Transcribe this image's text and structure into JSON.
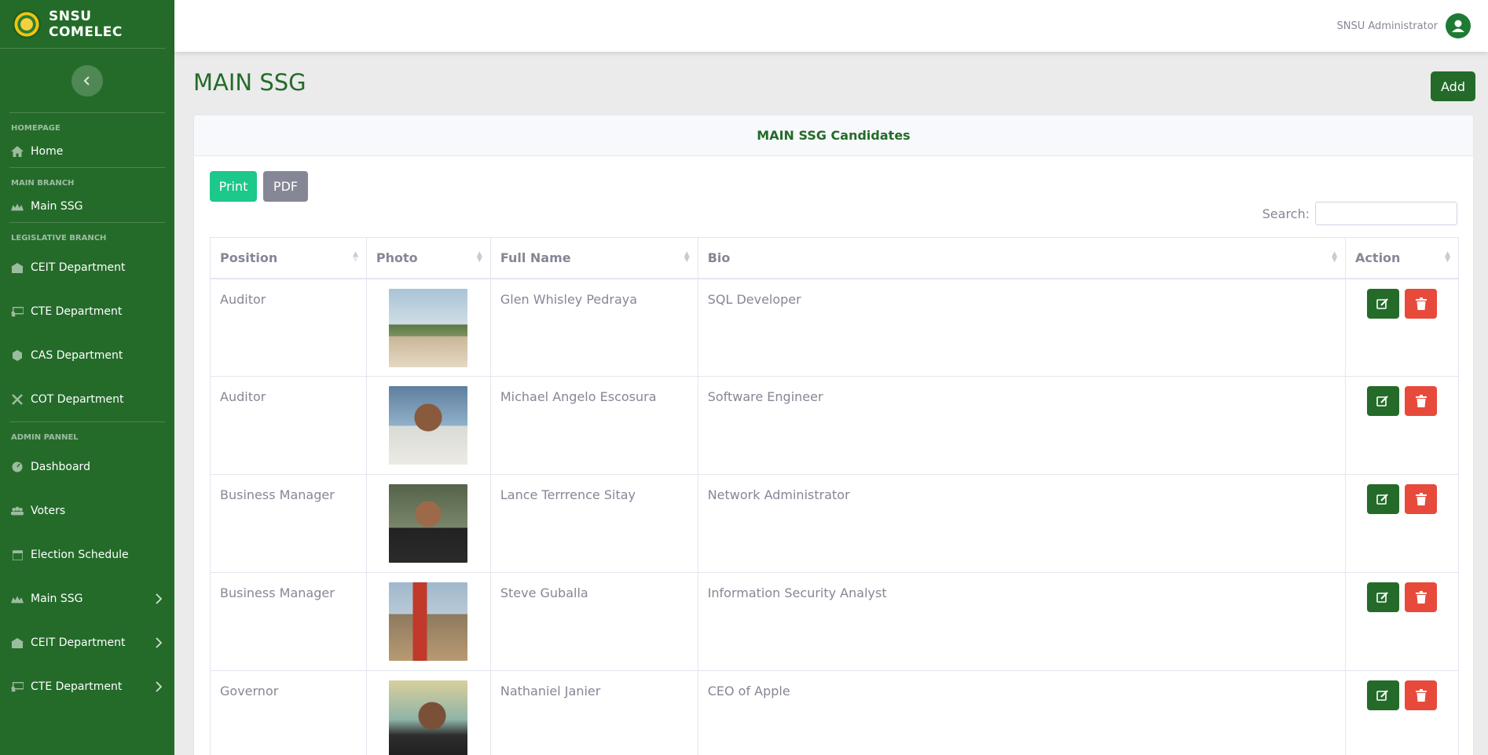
{
  "brand": {
    "name": "SNSU COMELEC"
  },
  "sidebar": {
    "sections": [
      {
        "heading": "HOMEPAGE",
        "items": [
          {
            "label": "Home",
            "icon": "home-icon"
          }
        ]
      },
      {
        "heading": "MAIN BRANCH",
        "items": [
          {
            "label": "Main SSG",
            "icon": "crowd-icon"
          }
        ]
      },
      {
        "heading": "LEGISLATIVE BRANCH",
        "items": [
          {
            "label": "CEIT Department",
            "icon": "building-icon"
          },
          {
            "label": "CTE Department",
            "icon": "chalkboard-icon"
          },
          {
            "label": "CAS Department",
            "icon": "cog-icon"
          },
          {
            "label": "COT Department",
            "icon": "tools-icon"
          }
        ]
      },
      {
        "heading": "ADMIN PANNEL",
        "items": [
          {
            "label": "Dashboard",
            "icon": "dashboard-icon"
          },
          {
            "label": "Voters",
            "icon": "users-icon"
          },
          {
            "label": "Election Schedule",
            "icon": "calendar-icon"
          },
          {
            "label": "Main SSG",
            "icon": "crowd-icon",
            "chevron": true
          },
          {
            "label": "CEIT Department",
            "icon": "building-icon",
            "chevron": true
          },
          {
            "label": "CTE Department",
            "icon": "chalkboard-icon",
            "chevron": true
          }
        ]
      }
    ]
  },
  "topbar": {
    "user_name": "SNSU Administrator"
  },
  "page": {
    "title": "MAIN SSG",
    "add_label": "Add"
  },
  "card": {
    "title": "MAIN SSG Candidates",
    "print_label": "Print",
    "pdf_label": "PDF",
    "search_label": "Search:",
    "search_value": ""
  },
  "table": {
    "columns": [
      "Position",
      "Photo",
      "Full Name",
      "Bio",
      "Action"
    ],
    "rows": [
      {
        "position": "Auditor",
        "full_name": "Glen Whisley Pedraya",
        "bio": "SQL Developer"
      },
      {
        "position": "Auditor",
        "full_name": "Michael Angelo Escosura",
        "bio": "Software Engineer"
      },
      {
        "position": "Business Manager",
        "full_name": "Lance Terrrence Sitay",
        "bio": "Network Administrator"
      },
      {
        "position": "Business Manager",
        "full_name": "Steve Guballa",
        "bio": "Information Security Analyst"
      },
      {
        "position": "Governor",
        "full_name": "Nathaniel Janier",
        "bio": "CEO of Apple"
      }
    ]
  },
  "colors": {
    "sidebar": "#246b2a",
    "accent": "#246b2a",
    "print": "#1cc88a",
    "pdf": "#858796",
    "delete": "#e74a3b"
  }
}
